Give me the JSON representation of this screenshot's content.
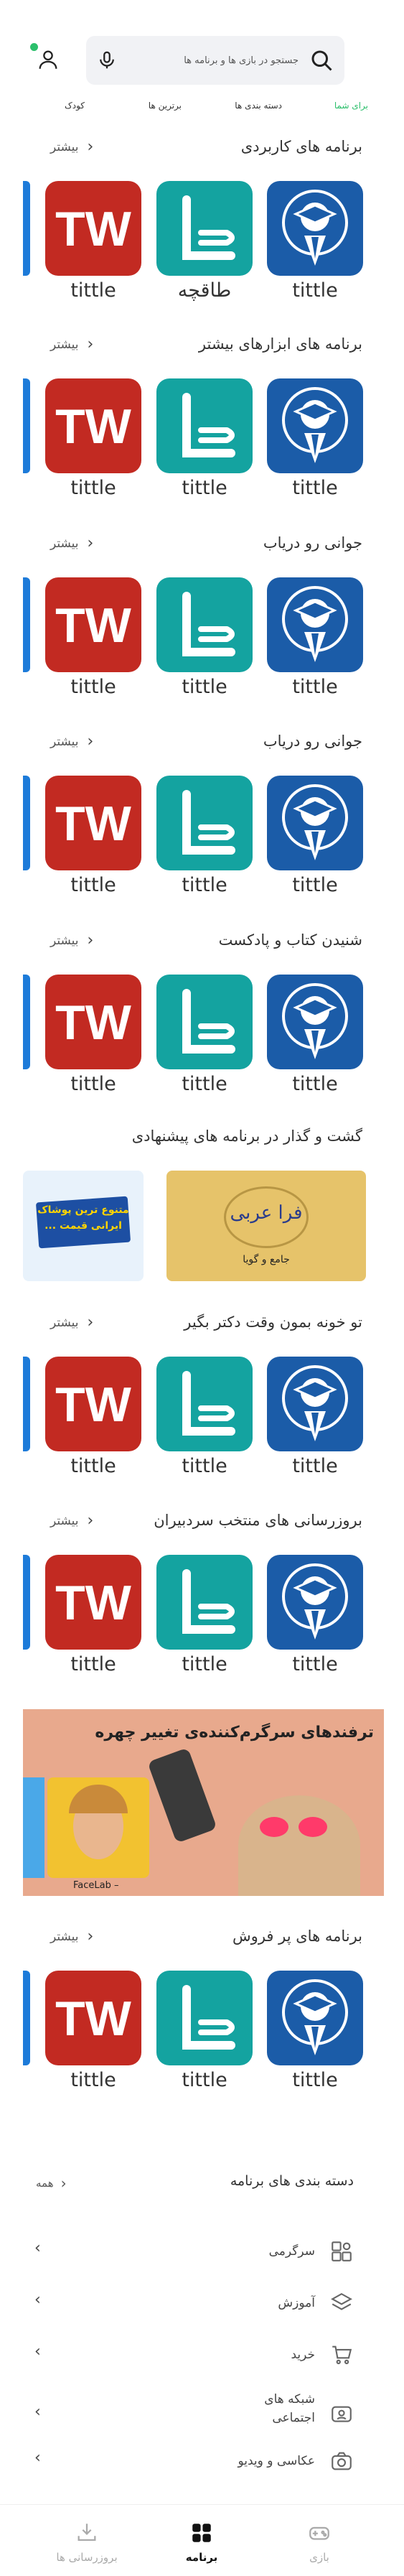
{
  "header": {
    "search_placeholder": "جستجو در بازی ها و برنامه ها",
    "tabs": [
      {
        "label": "برای شما",
        "active": true
      },
      {
        "label": "دسته بندی ها",
        "active": false
      },
      {
        "label": "برترین ها",
        "active": false
      },
      {
        "label": "کودک",
        "active": false
      }
    ]
  },
  "sections": [
    {
      "title": "برنامه های کاربردی",
      "more": "بیشتر",
      "apps": [
        "tittle",
        "طاقچه",
        "tittle"
      ]
    },
    {
      "title": "برنامه های ابزارهای بیشتر",
      "more": "بیشتر",
      "apps": [
        "tittle",
        "tittle",
        "tittle"
      ]
    },
    {
      "title": "جوانی رو دریاب",
      "more": "بیشتر",
      "apps": [
        "tittle",
        "tittle",
        "tittle"
      ]
    },
    {
      "title": "جوانی رو دریاب",
      "more": "بیشتر",
      "apps": [
        "tittle",
        "tittle",
        "tittle"
      ]
    },
    {
      "title": "شنیدن کتاب و پادکست",
      "more": "بیشتر",
      "apps": [
        "tittle",
        "tittle",
        "tittle"
      ]
    },
    {
      "title": "تو خونه بمون وقت دکتر بگیر",
      "more": "بیشتر",
      "apps": [
        "tittle",
        "tittle",
        "tittle"
      ]
    },
    {
      "title": "بروزرسانی های منتخب سردبیران",
      "more": "بیشتر",
      "apps": [
        "tittle",
        "tittle",
        "tittle"
      ]
    },
    {
      "title": "برنامه های پر فروش",
      "more": "بیشتر",
      "apps": [
        "tittle",
        "tittle",
        "tittle"
      ]
    }
  ],
  "suggested": {
    "title": "گشت و گذار در برنامه های پیشنهادی",
    "banner1_text": "متنوع ترین پوشاک ایرانی قیمت ...",
    "banner2_title": "فرا عربی",
    "banner2_sub": "جامع و گویا"
  },
  "promo": {
    "title": "ترفندهای سرگرم‌کننده‌ی تغییر چهره",
    "app_name": "FaceLab –"
  },
  "categories": {
    "title": "دسته بندی های برنامه",
    "all_label": "همه",
    "items": [
      {
        "label": "سرگرمی",
        "icon": "puzzle-icon"
      },
      {
        "label": "آموزش",
        "icon": "layers-icon"
      },
      {
        "label": "خرید",
        "icon": "cart-icon"
      },
      {
        "label": "شبکه های اجتماعی",
        "icon": "chat-icon"
      },
      {
        "label": "عکاسی و ویدیو",
        "icon": "camera-icon"
      }
    ]
  },
  "bottom_nav": [
    {
      "label": "بروزرسانی ها",
      "icon": "update-icon",
      "active": false
    },
    {
      "label": "برنامه",
      "icon": "apps-icon",
      "active": true
    },
    {
      "label": "بازی",
      "icon": "gamepad-icon",
      "active": false
    }
  ],
  "colors": {
    "accent": "#2bbf6b",
    "tw_red": "#c22a22",
    "taaghche_teal": "#14a3a0",
    "grad_blue": "#1b5ca8"
  }
}
